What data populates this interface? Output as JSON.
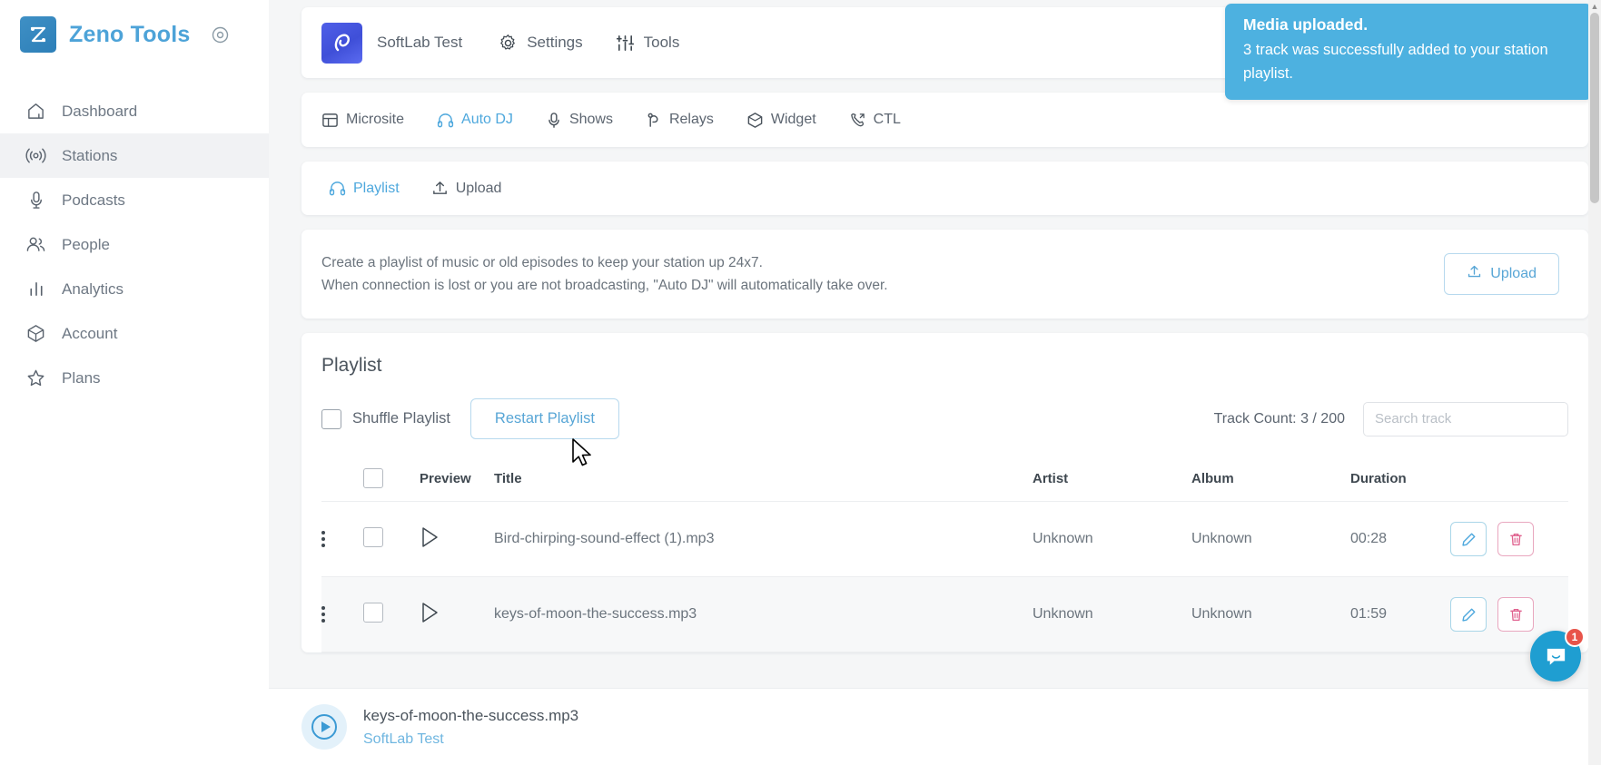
{
  "sidebar": {
    "brand": "Zeno Tools",
    "items": [
      {
        "label": "Dashboard",
        "icon": "home-icon"
      },
      {
        "label": "Stations",
        "icon": "broadcast-icon"
      },
      {
        "label": "Podcasts",
        "icon": "microphone-icon"
      },
      {
        "label": "People",
        "icon": "users-icon"
      },
      {
        "label": "Analytics",
        "icon": "bar-chart-icon"
      },
      {
        "label": "Account",
        "icon": "box-icon"
      },
      {
        "label": "Plans",
        "icon": "star-icon"
      }
    ],
    "active": "Stations"
  },
  "station_header": {
    "name": "SoftLab Test",
    "settings_label": "Settings",
    "tools_label": "Tools"
  },
  "tabs": [
    {
      "label": "Microsite",
      "icon": "layout-icon",
      "active": false
    },
    {
      "label": "Auto DJ",
      "icon": "headphones-icon",
      "active": true
    },
    {
      "label": "Shows",
      "icon": "microphone-icon",
      "active": false
    },
    {
      "label": "Relays",
      "icon": "relay-icon",
      "active": false
    },
    {
      "label": "Widget",
      "icon": "cube-icon",
      "active": false
    },
    {
      "label": "CTL",
      "icon": "phone-icon",
      "active": false
    }
  ],
  "subtabs": [
    {
      "label": "Playlist",
      "icon": "headphones-icon",
      "active": true
    },
    {
      "label": "Upload",
      "icon": "upload-icon",
      "active": false
    }
  ],
  "info": {
    "line1": "Create a playlist of music or old episodes to keep your station up 24x7.",
    "line2": "When connection is lost or you are not broadcasting, \"Auto DJ\" will automatically take over.",
    "upload_label": "Upload"
  },
  "playlist": {
    "title": "Playlist",
    "shuffle_label": "Shuffle Playlist",
    "shuffle_checked": false,
    "restart_label": "Restart Playlist",
    "track_count_label": "Track Count: 3 / 200",
    "search_placeholder": "Search track",
    "search_value": "",
    "columns": [
      "",
      "",
      "Preview",
      "Title",
      "Artist",
      "Album",
      "Duration",
      ""
    ],
    "rows": [
      {
        "title": "Bird-chirping-sound-effect (1).mp3",
        "artist": "Unknown",
        "album": "Unknown",
        "duration": "00:28"
      },
      {
        "title": "keys-of-moon-the-success.mp3",
        "artist": "Unknown",
        "album": "Unknown",
        "duration": "01:59"
      }
    ]
  },
  "toast": {
    "title": "Media uploaded.",
    "message": "3 track was successfully added to your station playlist.",
    "color": "#4db1e0"
  },
  "player": {
    "track": "keys-of-moon-the-success.mp3",
    "station": "SoftLab Test"
  },
  "intercom": {
    "badge": "1",
    "color": "#1f9ed1"
  }
}
